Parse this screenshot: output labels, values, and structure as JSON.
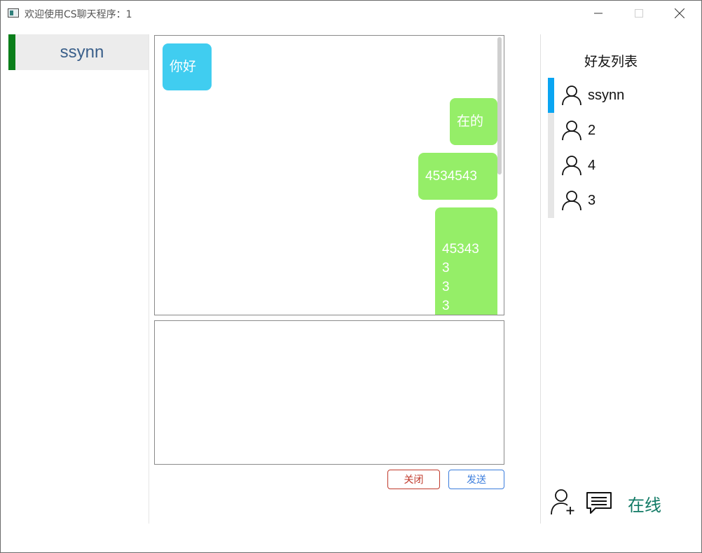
{
  "window": {
    "title": "欢迎使用CS聊天程序：1"
  },
  "sessions": [
    {
      "label": "ssynn",
      "active": true
    }
  ],
  "chat": {
    "messages": [
      {
        "side": "left",
        "text": "你好"
      },
      {
        "side": "right",
        "text": "在的"
      },
      {
        "side": "right",
        "text": "4534543"
      },
      {
        "side": "right",
        "lines": [
          "45343",
          "3",
          "3",
          "3"
        ]
      }
    ],
    "input_value": ""
  },
  "buttons": {
    "close_label": "关闭",
    "send_label": "发送"
  },
  "friends": {
    "title": "好友列表",
    "items": [
      {
        "name": "ssynn",
        "active": true,
        "icon": "user-icon"
      },
      {
        "name": "2",
        "active": false,
        "icon": "user-icon"
      },
      {
        "name": "4",
        "active": false,
        "icon": "user-icon"
      },
      {
        "name": "3",
        "active": false,
        "icon": "user-icon"
      }
    ]
  },
  "footer": {
    "status": "在线",
    "icons": [
      "add-friend-icon",
      "message-icon"
    ]
  },
  "colors": {
    "session_indicator": "#0a7e1a",
    "incoming_bubble": "#40cdf0",
    "outgoing_bubble": "#95ee68",
    "friend_active": "#0aa5f2",
    "status": "#117a65",
    "close_button": "#c0392b",
    "send_button": "#3b7ddd"
  }
}
